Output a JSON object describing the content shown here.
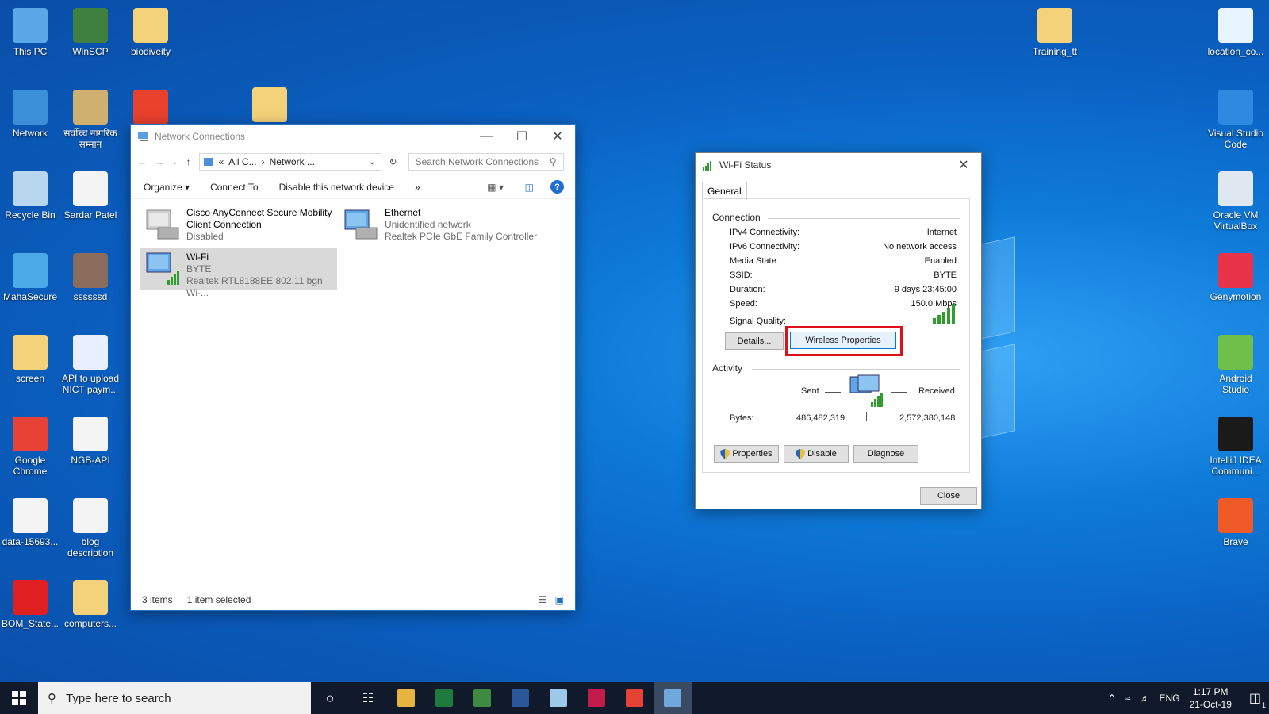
{
  "desktop": {
    "left_col1": [
      {
        "label": "This PC",
        "color": "#5aa8e8"
      },
      {
        "label": "Network",
        "color": "#3b8fd8"
      },
      {
        "label": "Recycle Bin",
        "color": "#b8d7ef"
      },
      {
        "label": "MahaSecure",
        "color": "#4aa9e6"
      },
      {
        "label": "screen",
        "color": "#f3d27a"
      },
      {
        "label": "Google Chrome",
        "color": "#e84135"
      },
      {
        "label": "data-15693...",
        "color": "#f4f4f4"
      },
      {
        "label": "BOM_State...",
        "color": "#e02020"
      }
    ],
    "left_col2": [
      {
        "label": "WinSCP",
        "color": "#3f7f3f"
      },
      {
        "label": "सर्वोच्च नागरिक सम्मान",
        "color": "#d0b070"
      },
      {
        "label": "Sardar Patel",
        "color": "#f4f4f4"
      },
      {
        "label": "ssssssd",
        "color": "#8a6c5c"
      },
      {
        "label": "API to upload NICT paym...",
        "color": "#e8f0ff"
      },
      {
        "label": "NGB-API",
        "color": "#f4f4f4"
      },
      {
        "label": "blog description",
        "color": "#f4f4f4"
      },
      {
        "label": "computers...",
        "color": "#f3d27a"
      }
    ],
    "left_col3": [
      {
        "label": "biodiveity",
        "color": "#f3d27a"
      },
      {
        "label": "",
        "color": "#e8412c"
      }
    ],
    "extra_folder": {
      "label": "",
      "color": "#f3d27a"
    },
    "top_right": {
      "label": "Training_tt",
      "color": "#f3d27a"
    },
    "right_col": [
      {
        "label": "location_co...",
        "color": "#e8f4ff"
      },
      {
        "label": "Visual Studio Code",
        "color": "#2d8ae0"
      },
      {
        "label": "Oracle VM VirtualBox",
        "color": "#dfe7f0"
      },
      {
        "label": "Genymotion",
        "color": "#e8334a"
      },
      {
        "label": "Android Studio",
        "color": "#6fbf4a"
      },
      {
        "label": "IntelliJ IDEA Communi...",
        "color": "#1a1a1a"
      },
      {
        "label": "Brave",
        "color": "#f05a28"
      }
    ]
  },
  "explorer": {
    "title": "Network Connections",
    "address_prefix": "«",
    "address_part1": "All C...",
    "address_part2": "Network ...",
    "search_placeholder": "Search Network Connections",
    "commands": [
      "Organize",
      "Connect To",
      "Disable this network device",
      "»"
    ],
    "items": [
      {
        "name": "Cisco AnyConnect Secure Mobility",
        "name2": "Client Connection",
        "status": "Disabled",
        "device": ""
      },
      {
        "name": "Ethernet",
        "name2": "",
        "status": "Unidentified network",
        "device": "Realtek PCIe GbE Family Controller"
      },
      {
        "name": "Wi-Fi",
        "name2": "",
        "status": "BYTE",
        "device": "Realtek RTL8188EE 802.11 bgn Wi-..."
      }
    ],
    "status_count": "3 items",
    "status_selected": "1 item selected"
  },
  "wifi_status": {
    "title": "Wi-Fi Status",
    "tab": "General",
    "connection_label": "Connection",
    "rows": [
      {
        "key": "IPv4 Connectivity:",
        "value": "Internet"
      },
      {
        "key": "IPv6 Connectivity:",
        "value": "No network access"
      },
      {
        "key": "Media State:",
        "value": "Enabled"
      },
      {
        "key": "SSID:",
        "value": "BYTE"
      },
      {
        "key": "Duration:",
        "value": "9 days 23:45:00"
      },
      {
        "key": "Speed:",
        "value": "150.0 Mbps"
      }
    ],
    "signal_label": "Signal Quality:",
    "details_btn": "Details...",
    "wireless_props_btn": "Wireless Properties",
    "activity_label": "Activity",
    "sent_label": "Sent",
    "received_label": "Received",
    "bytes_label": "Bytes:",
    "bytes_sent": "486,482,319",
    "bytes_received": "2,572,380,148",
    "properties_btn": "Properties",
    "disable_btn": "Disable",
    "diagnose_btn": "Diagnose",
    "close_btn": "Close",
    "highlight_color": "#e0101a"
  },
  "taskbar": {
    "search_placeholder": "Type here to search",
    "apps": [
      "#e8b440",
      "#1f7a3d",
      "#3e8a3e",
      "#2b579a",
      "#9ec8e8",
      "#c21d4a",
      "#e84135",
      "#6fa8dc"
    ],
    "lang": "ENG",
    "time": "1:17 PM",
    "date": "21-Oct-19",
    "notif_count": "1"
  }
}
